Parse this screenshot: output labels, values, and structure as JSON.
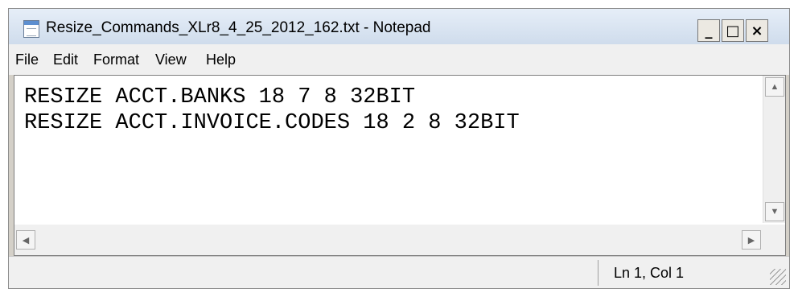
{
  "window": {
    "title": "Resize_Commands_XLr8_4_25_2012_162.txt - Notepad",
    "controls": {
      "minimize": "_",
      "maximize": "□",
      "close": "×"
    }
  },
  "menu": {
    "items": [
      {
        "label": "File"
      },
      {
        "label": "Edit"
      },
      {
        "label": "Format"
      },
      {
        "label": "View"
      },
      {
        "label": "Help"
      }
    ]
  },
  "editor": {
    "lines": [
      "RESIZE ACCT.BANKS 18 7 8 32BIT",
      "RESIZE ACCT.INVOICE.CODES 18 2 8 32BIT"
    ]
  },
  "statusbar": {
    "position": "Ln 1, Col 1"
  },
  "icons": {
    "app": "notepad-icon",
    "scroll_up": "arrow-up-icon",
    "scroll_down": "arrow-down-icon",
    "scroll_left": "arrow-left-icon",
    "scroll_right": "arrow-right-icon",
    "grip": "size-grip-icon"
  }
}
